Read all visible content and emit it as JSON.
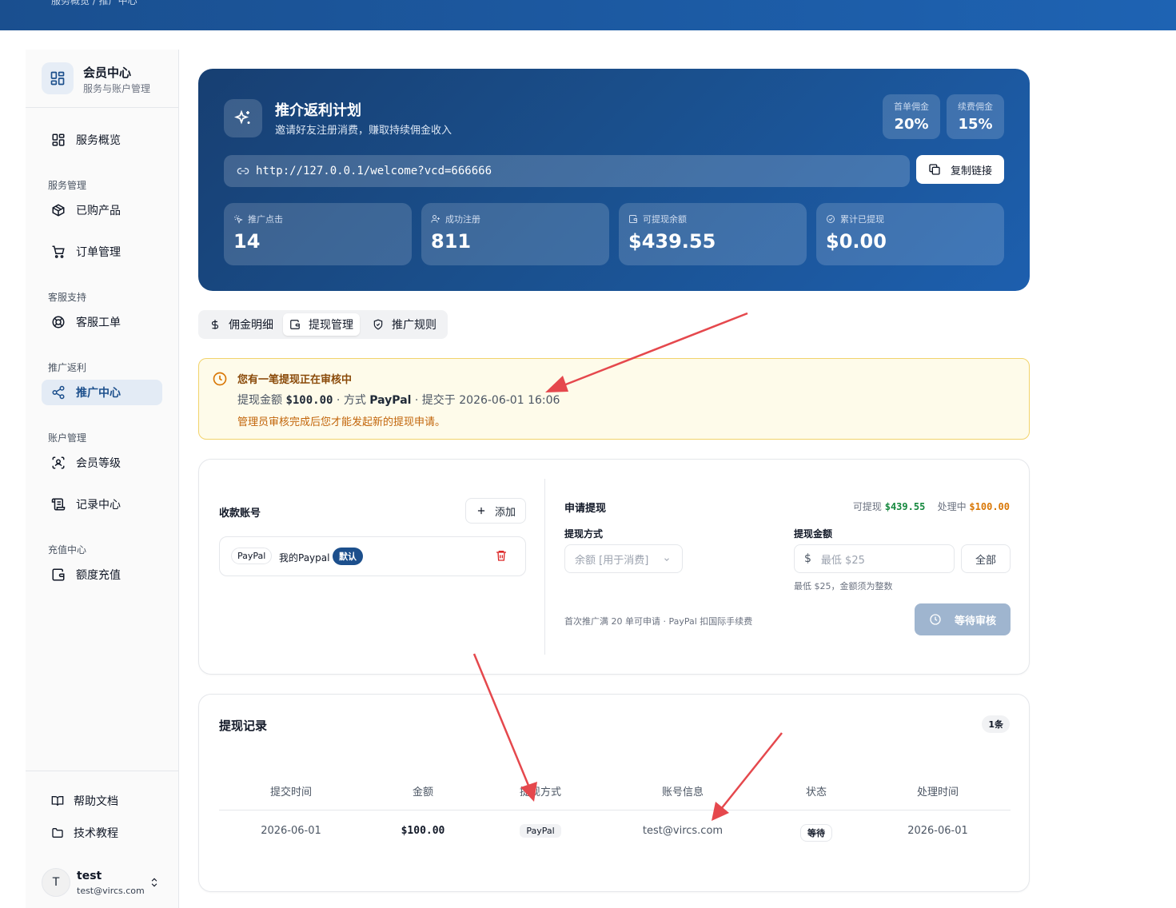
{
  "topbar": {
    "breadcrumb": "服务概览  /  推广中心"
  },
  "sidebar": {
    "title": "会员中心",
    "subtitle": "服务与账户管理",
    "overview": "服务概览",
    "groups": {
      "service": "服务管理",
      "support": "客服支持",
      "referral": "推广返利",
      "account": "账户管理",
      "recharge": "充值中心"
    },
    "items": {
      "products": "已购产品",
      "orders": "订单管理",
      "tickets": "客服工单",
      "referral_center": "推广中心",
      "level": "会员等级",
      "records": "记录中心",
      "topup": "额度充值"
    },
    "footer": {
      "docs": "帮助文档",
      "tutorials": "技术教程"
    },
    "user": {
      "initial": "T",
      "name": "test",
      "email": "test@vircs.com"
    }
  },
  "hero": {
    "title": "推介返利计划",
    "subtitle": "邀请好友注册消费，赚取持续佣金收入",
    "first_rate_label": "首单佣金",
    "first_rate": "20%",
    "renew_rate_label": "续费佣金",
    "renew_rate": "15%",
    "link": "http://127.0.0.1/welcome?vcd=666666",
    "copy_label": "复制链接",
    "stats": [
      {
        "label": "推广点击",
        "value": "14"
      },
      {
        "label": "成功注册",
        "value": "811"
      },
      {
        "label": "可提现余额",
        "value": "$439.55"
      },
      {
        "label": "累计已提现",
        "value": "$0.00"
      }
    ]
  },
  "tabs": {
    "commission": "佣金明细",
    "withdraw": "提现管理",
    "rules": "推广规则"
  },
  "alert": {
    "title": "您有一笔提现正在审核中",
    "amount_label": "提现金额",
    "amount": "$100.00",
    "method_label": "· 方式",
    "method": "PayPal",
    "submitted": "· 提交于 2026-06-01 16:06",
    "note": "管理员审核完成后您才能发起新的提现申请。"
  },
  "accounts": {
    "title": "收款账号",
    "add_label": "添加",
    "items": [
      {
        "type": "PayPal",
        "name": "我的Paypal",
        "badge": "默认"
      }
    ]
  },
  "withdraw": {
    "title": "申请提现",
    "available_label": "可提现",
    "available": "$439.55",
    "processing_label": "处理中",
    "processing": "$100.00",
    "method_label": "提现方式",
    "method_value": "余额 [用于消费]",
    "amount_label": "提现金额",
    "currency": "$",
    "amount_placeholder": "最低 $25",
    "all_label": "全部",
    "amount_hint": "最低 $25，金额须为整数",
    "rule_hint": "首次推广满 20 单可申请 · PayPal 扣国际手续费",
    "submit_label": "等待审核"
  },
  "records": {
    "title": "提现记录",
    "count": "1条",
    "headers": [
      "提交时间",
      "金额",
      "提现方式",
      "账号信息",
      "状态",
      "处理时间"
    ],
    "rows": [
      {
        "submitted": "2026-06-01",
        "amount": "$100.00",
        "method": "PayPal",
        "account": "test@vircs.com",
        "status": "等待",
        "processed": "2026-06-01"
      }
    ]
  },
  "colors": {
    "brand": "#1c4f8c",
    "alert_bg": "#fefbea",
    "alert_border": "#f2d36b",
    "available": "#15883e",
    "processing": "#d97706",
    "arrow": "#e5484d"
  }
}
